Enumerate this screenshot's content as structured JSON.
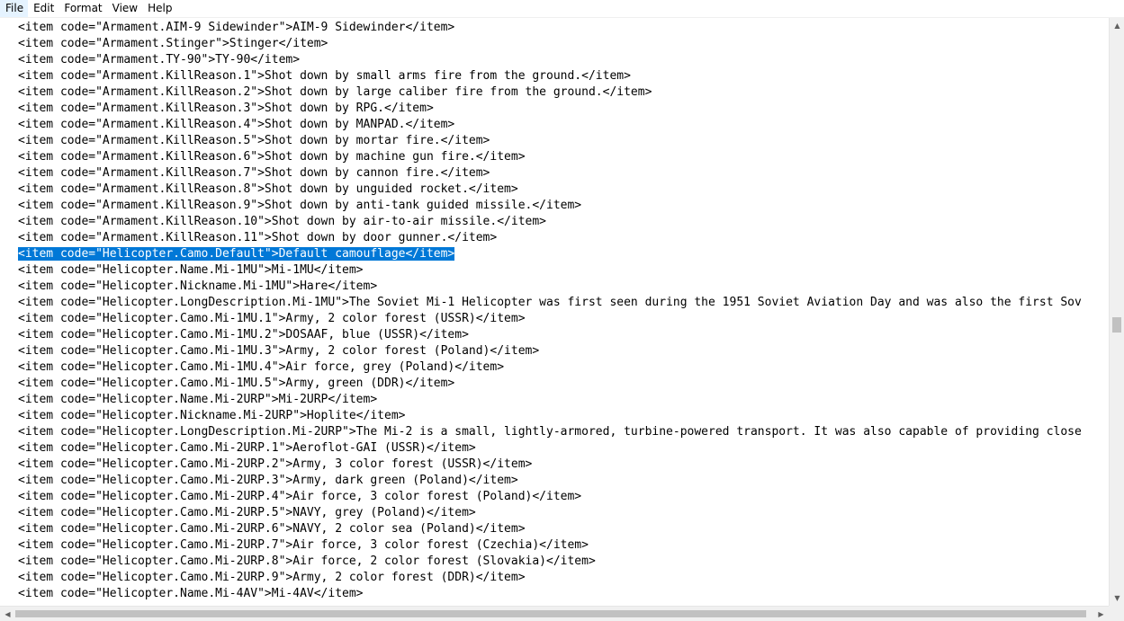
{
  "menu": {
    "file": "File",
    "edit": "Edit",
    "format": "Format",
    "view": "View",
    "help": "Help"
  },
  "editor": {
    "lines": [
      "<item code=\"Armament.AIM-9 Sidewinder\">AIM-9 Sidewinder</item>",
      "<item code=\"Armament.Stinger\">Stinger</item>",
      "<item code=\"Armament.TY-90\">TY-90</item>",
      "<item code=\"Armament.KillReason.1\">Shot down by small arms fire from the ground.</item>",
      "<item code=\"Armament.KillReason.2\">Shot down by large caliber fire from the ground.</item>",
      "<item code=\"Armament.KillReason.3\">Shot down by RPG.</item>",
      "<item code=\"Armament.KillReason.4\">Shot down by MANPAD.</item>",
      "<item code=\"Armament.KillReason.5\">Shot down by mortar fire.</item>",
      "<item code=\"Armament.KillReason.6\">Shot down by machine gun fire.</item>",
      "<item code=\"Armament.KillReason.7\">Shot down by cannon fire.</item>",
      "<item code=\"Armament.KillReason.8\">Shot down by unguided rocket.</item>",
      "<item code=\"Armament.KillReason.9\">Shot down by anti-tank guided missile.</item>",
      "<item code=\"Armament.KillReason.10\">Shot down by air-to-air missile.</item>",
      "<item code=\"Armament.KillReason.11\">Shot down by door gunner.</item>",
      "<item code=\"Helicopter.Camo.Default\">Default camouflage</item>",
      "<item code=\"Helicopter.Name.Mi-1MU\">Mi-1MU</item>",
      "<item code=\"Helicopter.Nickname.Mi-1MU\">Hare</item>",
      "<item code=\"Helicopter.LongDescription.Mi-1MU\">The Soviet Mi-1 Helicopter was first seen during the 1951 Soviet Aviation Day and was also the first Sov",
      "<item code=\"Helicopter.Camo.Mi-1MU.1\">Army, 2 color forest (USSR)</item>",
      "<item code=\"Helicopter.Camo.Mi-1MU.2\">DOSAAF, blue (USSR)</item>",
      "<item code=\"Helicopter.Camo.Mi-1MU.3\">Army, 2 color forest (Poland)</item>",
      "<item code=\"Helicopter.Camo.Mi-1MU.4\">Air force, grey (Poland)</item>",
      "<item code=\"Helicopter.Camo.Mi-1MU.5\">Army, green (DDR)</item>",
      "<item code=\"Helicopter.Name.Mi-2URP\">Mi-2URP</item>",
      "<item code=\"Helicopter.Nickname.Mi-2URP\">Hoplite</item>",
      "<item code=\"Helicopter.LongDescription.Mi-2URP\">The Mi-2 is a small, lightly-armored, turbine-powered transport. It was also capable of providing close",
      "<item code=\"Helicopter.Camo.Mi-2URP.1\">Aeroflot-GAI (USSR)</item>",
      "<item code=\"Helicopter.Camo.Mi-2URP.2\">Army, 3 color forest (USSR)</item>",
      "<item code=\"Helicopter.Camo.Mi-2URP.3\">Army, dark green (Poland)</item>",
      "<item code=\"Helicopter.Camo.Mi-2URP.4\">Air force, 3 color forest (Poland)</item>",
      "<item code=\"Helicopter.Camo.Mi-2URP.5\">NAVY, grey (Poland)</item>",
      "<item code=\"Helicopter.Camo.Mi-2URP.6\">NAVY, 2 color sea (Poland)</item>",
      "<item code=\"Helicopter.Camo.Mi-2URP.7\">Air force, 3 color forest (Czechia)</item>",
      "<item code=\"Helicopter.Camo.Mi-2URP.8\">Air force, 2 color forest (Slovakia)</item>",
      "<item code=\"Helicopter.Camo.Mi-2URP.9\">Army, 2 color forest (DDR)</item>",
      "<item code=\"Helicopter.Name.Mi-4AV\">Mi-4AV</item>"
    ],
    "selected_line": 14
  },
  "scrollbars": {
    "up_arrow": "▲",
    "down_arrow": "▼",
    "left_arrow": "◀",
    "right_arrow": "▶"
  }
}
